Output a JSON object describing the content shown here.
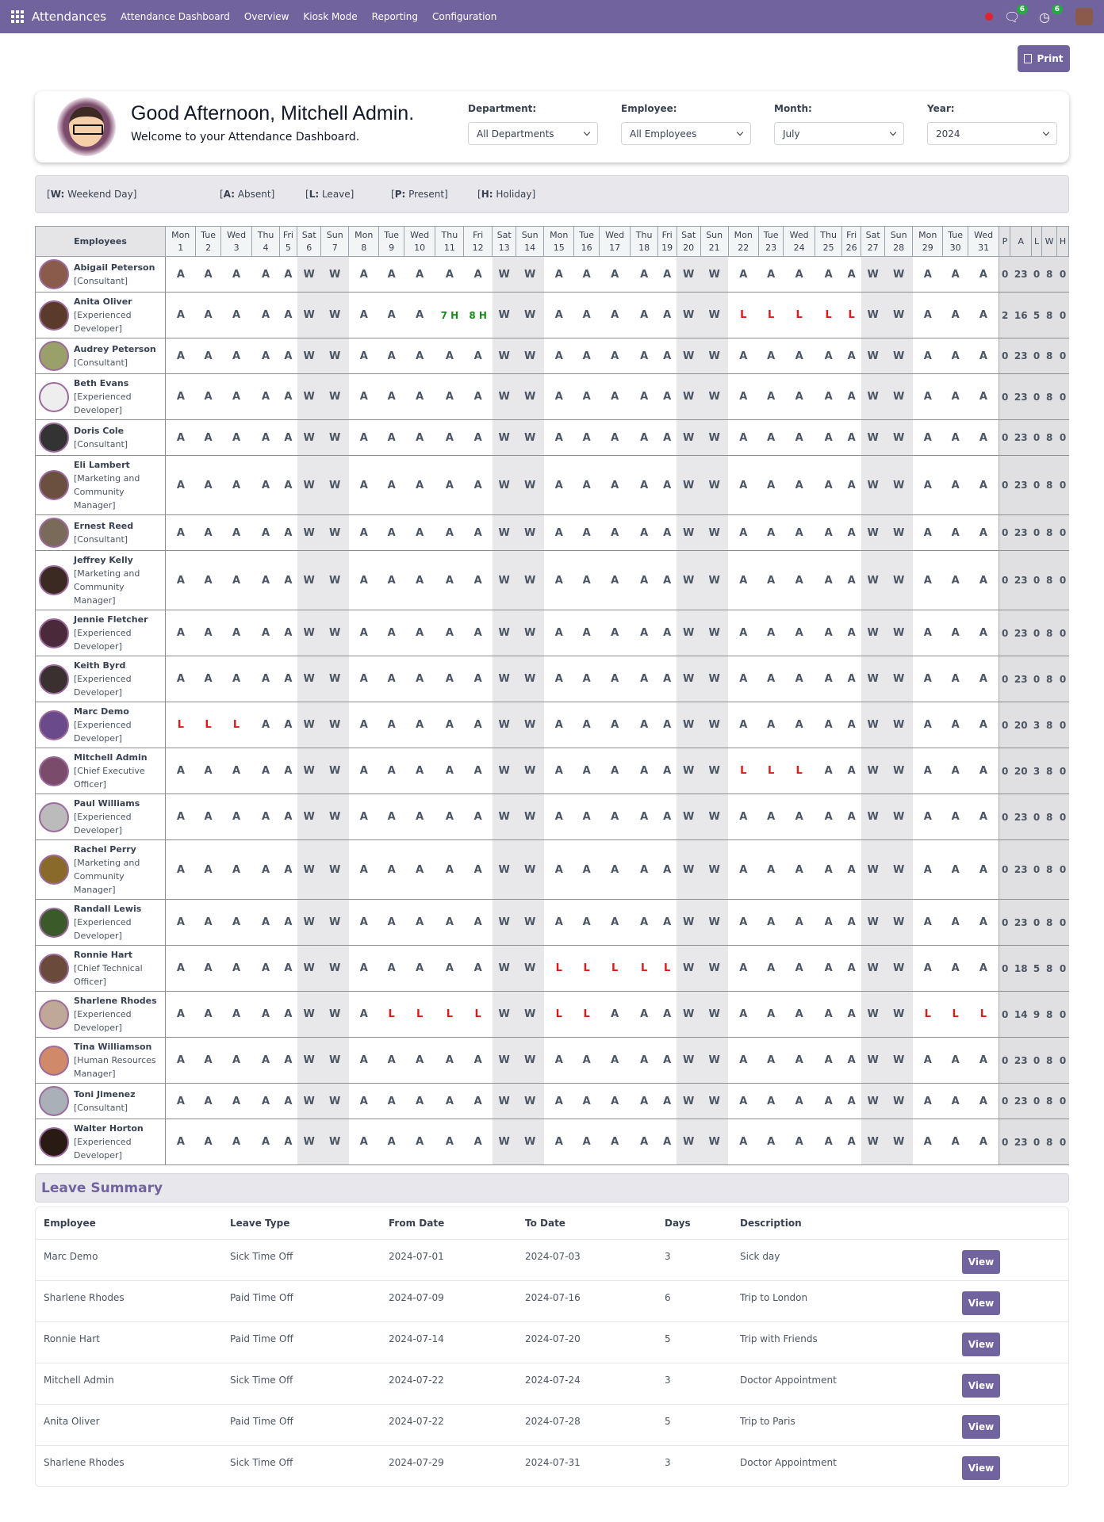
{
  "nav": {
    "app_name": "Attendances",
    "menu": [
      "Attendance Dashboard",
      "Overview",
      "Kiosk Mode",
      "Reporting",
      "Configuration"
    ],
    "chat_badge": "6",
    "activity_badge": "6"
  },
  "print_label": "Print",
  "welcome": {
    "greeting": "Good Afternoon, Mitchell Admin.",
    "subtitle": "Welcome to your Attendance Dashboard."
  },
  "filters": [
    {
      "label": "Department:",
      "value": "All Departments"
    },
    {
      "label": "Employee:",
      "value": "All Employees"
    },
    {
      "label": "Month:",
      "value": "July"
    },
    {
      "label": "Year:",
      "value": "2024"
    }
  ],
  "legend": [
    {
      "key": "W:",
      "text": " Weekend Day"
    },
    {
      "key": "A:",
      "text": " Absent"
    },
    {
      "key": "L:",
      "text": " Leave"
    },
    {
      "key": "P:",
      "text": " Present"
    },
    {
      "key": "H:",
      "text": " Holiday"
    }
  ],
  "table": {
    "employees_header": "Employees",
    "days": [
      [
        "Mon",
        "1"
      ],
      [
        "Tue",
        "2"
      ],
      [
        "Wed",
        "3"
      ],
      [
        "Thu",
        "4"
      ],
      [
        "Fri",
        "5"
      ],
      [
        "Sat",
        "6"
      ],
      [
        "Sun",
        "7"
      ],
      [
        "Mon",
        "8"
      ],
      [
        "Tue",
        "9"
      ],
      [
        "Wed",
        "10"
      ],
      [
        "Thu",
        "11"
      ],
      [
        "Fri",
        "12"
      ],
      [
        "Sat",
        "13"
      ],
      [
        "Sun",
        "14"
      ],
      [
        "Mon",
        "15"
      ],
      [
        "Tue",
        "16"
      ],
      [
        "Wed",
        "17"
      ],
      [
        "Thu",
        "18"
      ],
      [
        "Fri",
        "19"
      ],
      [
        "Sat",
        "20"
      ],
      [
        "Sun",
        "21"
      ],
      [
        "Mon",
        "22"
      ],
      [
        "Tue",
        "23"
      ],
      [
        "Wed",
        "24"
      ],
      [
        "Thu",
        "25"
      ],
      [
        "Fri",
        "26"
      ],
      [
        "Sat",
        "27"
      ],
      [
        "Sun",
        "28"
      ],
      [
        "Mon",
        "29"
      ],
      [
        "Tue",
        "30"
      ],
      [
        "Wed",
        "31"
      ]
    ],
    "totals_headers": [
      "P",
      "A",
      "L",
      "W",
      "H"
    ],
    "rows": [
      {
        "name": "Abigail Peterson",
        "job": "[Consultant]",
        "leave_days": [],
        "present": {},
        "totals": [
          0,
          23,
          0,
          8,
          0
        ],
        "color": "#8a5a4a"
      },
      {
        "name": "Anita Oliver",
        "job": "[Experienced Developer]",
        "leave_days": [
          22,
          23,
          24,
          25,
          26
        ],
        "present": {
          "11": "7 H",
          "12": "8 H"
        },
        "totals": [
          2,
          16,
          5,
          8,
          0
        ],
        "color": "#5a3a2a"
      },
      {
        "name": "Audrey Peterson",
        "job": "[Consultant]",
        "leave_days": [],
        "present": {},
        "totals": [
          0,
          23,
          0,
          8,
          0
        ],
        "color": "#9aa06a"
      },
      {
        "name": "Beth Evans",
        "job": "[Experienced Developer]",
        "leave_days": [],
        "present": {},
        "totals": [
          0,
          23,
          0,
          8,
          0
        ],
        "color": "#eeeeee"
      },
      {
        "name": "Doris Cole",
        "job": "[Consultant]",
        "leave_days": [],
        "present": {},
        "totals": [
          0,
          23,
          0,
          8,
          0
        ],
        "color": "#333333"
      },
      {
        "name": "Eli Lambert",
        "job": "[Marketing and Community Manager]",
        "leave_days": [],
        "present": {},
        "totals": [
          0,
          23,
          0,
          8,
          0
        ],
        "color": "#6b5040"
      },
      {
        "name": "Ernest Reed",
        "job": "[Consultant]",
        "leave_days": [],
        "present": {},
        "totals": [
          0,
          23,
          0,
          8,
          0
        ],
        "color": "#7a6a5a"
      },
      {
        "name": "Jeffrey Kelly",
        "job": "[Marketing and Community Manager]",
        "leave_days": [],
        "present": {},
        "totals": [
          0,
          23,
          0,
          8,
          0
        ],
        "color": "#3a2a22"
      },
      {
        "name": "Jennie Fletcher",
        "job": "[Experienced Developer]",
        "leave_days": [],
        "present": {},
        "totals": [
          0,
          23,
          0,
          8,
          0
        ],
        "color": "#4a2a3a"
      },
      {
        "name": "Keith Byrd",
        "job": "[Experienced Developer]",
        "leave_days": [],
        "present": {},
        "totals": [
          0,
          23,
          0,
          8,
          0
        ],
        "color": "#3a3030"
      },
      {
        "name": "Marc Demo",
        "job": "[Experienced Developer]",
        "leave_days": [
          1,
          2,
          3
        ],
        "present": {},
        "totals": [
          0,
          20,
          3,
          8,
          0
        ],
        "color": "#6a4a8a"
      },
      {
        "name": "Mitchell Admin",
        "job": "[Chief Executive Officer]",
        "leave_days": [
          22,
          23,
          24
        ],
        "present": {},
        "totals": [
          0,
          20,
          3,
          8,
          0
        ],
        "color": "#7a4b6a"
      },
      {
        "name": "Paul Williams",
        "job": "[Experienced Developer]",
        "leave_days": [],
        "present": {},
        "totals": [
          0,
          23,
          0,
          8,
          0
        ],
        "color": "#bbbbbb"
      },
      {
        "name": "Rachel Perry",
        "job": "[Marketing and Community Manager]",
        "leave_days": [],
        "present": {},
        "totals": [
          0,
          23,
          0,
          8,
          0
        ],
        "color": "#8a6a2a"
      },
      {
        "name": "Randall Lewis",
        "job": "[Experienced Developer]",
        "leave_days": [],
        "present": {},
        "totals": [
          0,
          23,
          0,
          8,
          0
        ],
        "color": "#3a5a2a"
      },
      {
        "name": "Ronnie Hart",
        "job": "[Chief Technical Officer]",
        "leave_days": [
          15,
          16,
          17,
          18,
          19
        ],
        "present": {},
        "totals": [
          0,
          18,
          5,
          8,
          0
        ],
        "color": "#6a4a3a"
      },
      {
        "name": "Sharlene Rhodes",
        "job": "[Experienced Developer]",
        "leave_days": [
          9,
          10,
          11,
          12,
          15,
          16,
          29,
          30,
          31
        ],
        "present": {},
        "totals": [
          0,
          14,
          9,
          8,
          0
        ],
        "color": "#c0a898"
      },
      {
        "name": "Tina Williamson",
        "job": "[Human Resources Manager]",
        "leave_days": [],
        "present": {},
        "totals": [
          0,
          23,
          0,
          8,
          0
        ],
        "color": "#d08a6a"
      },
      {
        "name": "Toni Jimenez",
        "job": "[Consultant]",
        "leave_days": [],
        "present": {},
        "totals": [
          0,
          23,
          0,
          8,
          0
        ],
        "color": "#aab0b8"
      },
      {
        "name": "Walter Horton",
        "job": "[Experienced Developer]",
        "leave_days": [],
        "present": {},
        "totals": [
          0,
          23,
          0,
          8,
          0
        ],
        "color": "#2a1a14"
      }
    ]
  },
  "leave_summary": {
    "title": "Leave Summary",
    "headers": [
      "Employee",
      "Leave Type",
      "From Date",
      "To Date",
      "Days",
      "Description",
      ""
    ],
    "view_label": "View",
    "rows": [
      [
        "Marc Demo",
        "Sick Time Off",
        "2024-07-01",
        "2024-07-03",
        "3",
        "Sick day"
      ],
      [
        "Sharlene Rhodes",
        "Paid Time Off",
        "2024-07-09",
        "2024-07-16",
        "6",
        "Trip to London"
      ],
      [
        "Ronnie Hart",
        "Paid Time Off",
        "2024-07-14",
        "2024-07-20",
        "5",
        "Trip with Friends"
      ],
      [
        "Mitchell Admin",
        "Sick Time Off",
        "2024-07-22",
        "2024-07-24",
        "3",
        "Doctor Appointment"
      ],
      [
        "Anita Oliver",
        "Paid Time Off",
        "2024-07-22",
        "2024-07-28",
        "5",
        "Trip to Paris"
      ],
      [
        "Sharlene Rhodes",
        "Sick Time Off",
        "2024-07-29",
        "2024-07-31",
        "3",
        "Doctor Appointment"
      ]
    ]
  }
}
